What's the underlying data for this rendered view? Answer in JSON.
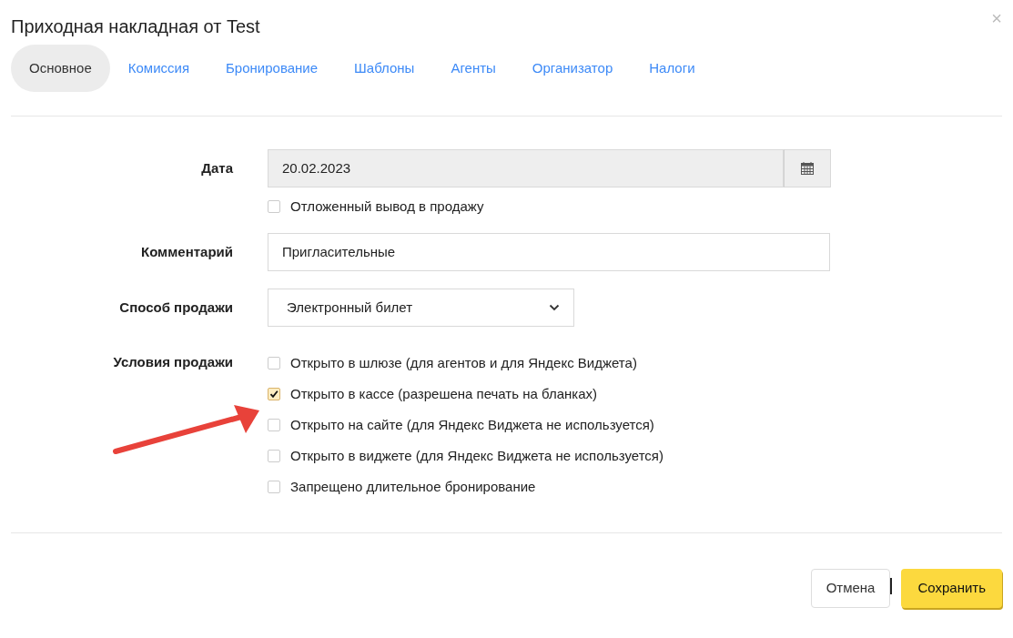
{
  "window": {
    "title": "Приходная накладная от Test",
    "close": "×"
  },
  "tabs": [
    {
      "label": "Основное",
      "selected": true
    },
    {
      "label": "Комиссия",
      "selected": false
    },
    {
      "label": "Бронирование",
      "selected": false
    },
    {
      "label": "Шаблоны",
      "selected": false
    },
    {
      "label": "Агенты",
      "selected": false
    },
    {
      "label": "Организатор",
      "selected": false
    },
    {
      "label": "Налоги",
      "selected": false
    }
  ],
  "form": {
    "date": {
      "label": "Дата",
      "value": "20.02.2023",
      "disabled": true
    },
    "delayed": {
      "label": "Отложенный вывод в продажу",
      "checked": false
    },
    "comment": {
      "label": "Комментарий",
      "value": "Пригласительные"
    },
    "sale_method": {
      "label": "Способ продажи",
      "value": "Электронный билет"
    },
    "conditions": {
      "label": "Условия продажи",
      "options": [
        {
          "label": "Открыто в шлюзе (для агентов и для Яндекс Виджета)",
          "checked": false
        },
        {
          "label": "Открыто в кассе (разрешена печать на бланках)",
          "checked": true
        },
        {
          "label": "Открыто на сайте (для Яндекс Виджета не используется)",
          "checked": false
        },
        {
          "label": "Открыто в виджете (для Яндекс Виджета не используется)",
          "checked": false
        },
        {
          "label": "Запрещено длительное бронирование",
          "checked": false
        }
      ]
    }
  },
  "buttons": [
    {
      "label": "Отмена",
      "kind": "secondary"
    },
    {
      "label": "Сохранить",
      "kind": "primary"
    }
  ]
}
